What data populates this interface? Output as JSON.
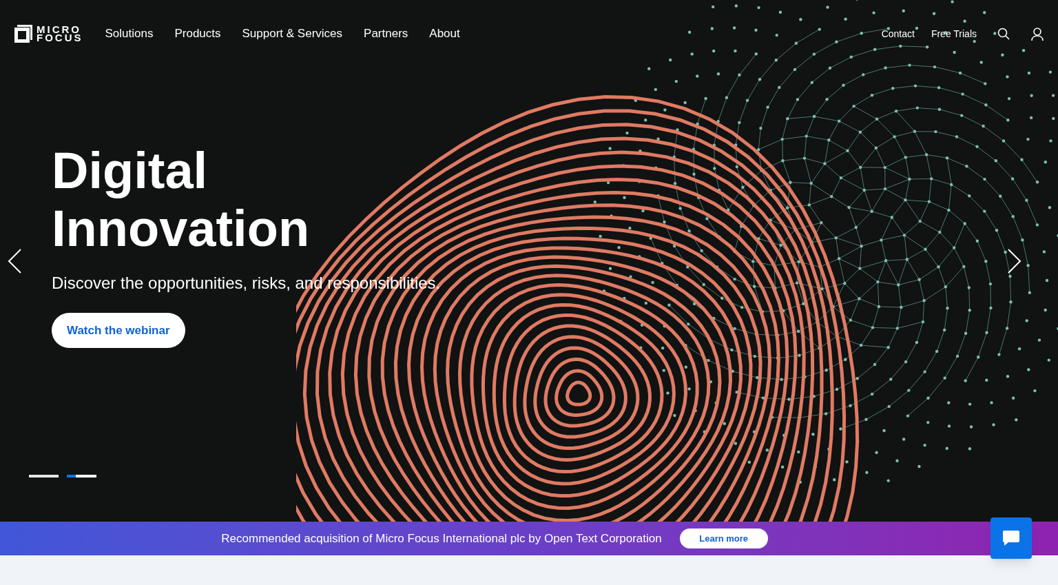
{
  "header": {
    "logo": {
      "line_1": "MICRO",
      "line_2": "FOCUS"
    },
    "nav": [
      "Solutions",
      "Products",
      "Support & Services",
      "Partners",
      "About"
    ],
    "utility_links": [
      "Contact",
      "Free Trials"
    ]
  },
  "hero": {
    "title_line_1": "Digital",
    "title_line_2": "Innovation",
    "subtitle": "Discover the opportunities, risks, and responsibilities.",
    "button": "Watch the webinar",
    "indicators": [
      {
        "selected": false
      },
      {
        "selected": true,
        "level": 0.3
      }
    ]
  },
  "banner": {
    "text": "Recommended acquisition of Micro Focus International plc by Open Text Corporation",
    "button": "Learn more"
  }
}
